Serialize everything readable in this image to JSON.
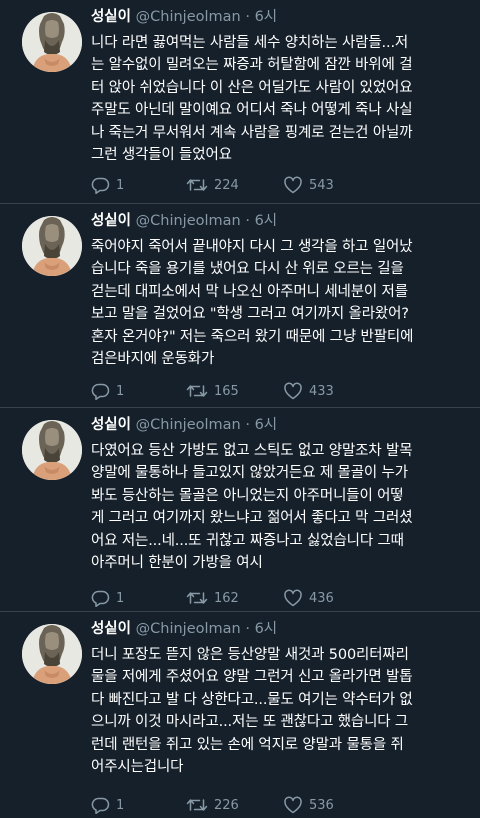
{
  "tweets": [
    {
      "name": "성싵이",
      "handle": "@Chinjeolman",
      "dot": "·",
      "time": "6시",
      "lines": [
        "니다 라면 끓여먹는 사람들 세수 양치하는 사람들...저",
        "는 알수없이 밀려오는 짜증과 허탈함에 잠깐 바위에 걸",
        "터 앉아 쉬었습니다 이 산은 어딜가도 사람이 있었어요",
        "주말도 아닌데 말이예요 어디서 죽나 어떻게 죽나 사실",
        "나 죽는거 무서워서 계속 사람을 핑계로 걷는건 아닐까",
        "그런 생각들이 들었어요"
      ],
      "replies": "1",
      "retweets": "224",
      "likes": "543"
    },
    {
      "name": "성싵이",
      "handle": "@Chinjeolman",
      "dot": "·",
      "time": "6시",
      "lines": [
        "죽어야지 죽어서 끝내야지 다시 그 생각을 하고 일어났",
        "습니다 죽을 용기를 냈어요 다시 산 위로 오르는 길을",
        "걷는데 대피소에서 막 나오신 아주머니 세네분이 저를",
        "보고 말을 걸었어요 \"학생 그러고 여기까지 올라왔어?",
        "혼자 온거야?\" 저는 죽으러 왔기 때문에 그냥 반팔티에",
        "검은바지에 운동화가"
      ],
      "replies": "1",
      "retweets": "165",
      "likes": "433"
    },
    {
      "name": "성싵이",
      "handle": "@Chinjeolman",
      "dot": "·",
      "time": "6시",
      "lines": [
        "다였어요 등산 가방도 없고 스틱도 없고 양말조차 발목",
        "양말에 물통하나 들고있지 않았거든요 제 몰골이 누가",
        "봐도 등산하는 몰골은 아니었는지 아주머니들이 어떻",
        "게 그러고 여기까지 왔느냐고 젊어서 좋다고 막 그러셨",
        "어요 저는...네...또 귀찮고 짜증나고 싫었습니다 그때",
        "아주머니 한분이 가방을 여시"
      ],
      "replies": "1",
      "retweets": "162",
      "likes": "436"
    },
    {
      "name": "성싵이",
      "handle": "@Chinjeolman",
      "dot": "·",
      "time": "6시",
      "lines": [
        "더니 포장도 뜯지 않은 등산양말 새것과 500리터짜리",
        "물을 저에게 주셨어요 양말 그런거 신고 올라가면 발톱",
        "다 빠진다고 발 다 상한다고...물도 여기는 약수터가 없",
        "으니까 이것 마시라고...저는 또 괜찮다고 했습니다 그",
        "런데 랜턴을 쥐고 있는 손에 억지로 양말과 물통을 쥐",
        "어주시는겁니다"
      ],
      "replies": "1",
      "retweets": "226",
      "likes": "536"
    }
  ]
}
